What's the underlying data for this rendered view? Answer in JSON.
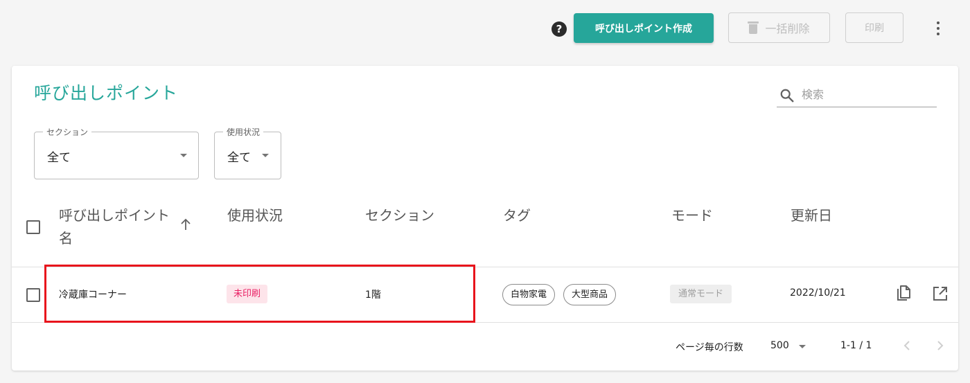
{
  "toolbar": {
    "help_glyph": "?",
    "create_label": "呼び出しポイント作成",
    "bulk_delete_label": "一括削除",
    "print_label": "印刷"
  },
  "card": {
    "title": "呼び出しポイント",
    "search_placeholder": "検索"
  },
  "filters": {
    "section": {
      "label": "セクション",
      "value": "全て"
    },
    "status": {
      "label": "使用状況",
      "value": "全て"
    }
  },
  "table": {
    "headers": {
      "name": "呼び出しポイント名",
      "status": "使用状況",
      "section": "セクション",
      "tags": "タグ",
      "mode": "モード",
      "updated": "更新日"
    },
    "rows": [
      {
        "name": "冷蔵庫コーナー",
        "status": "未印刷",
        "section": "1階",
        "tags": [
          "白物家電",
          "大型商品"
        ],
        "mode": "通常モード",
        "updated": "2022/10/21"
      }
    ]
  },
  "pagination": {
    "rows_per_page_label": "ページ毎の行数",
    "rows_per_page": "500",
    "range": "1-1 / 1"
  },
  "colors": {
    "accent": "#26a69a",
    "status_unprinted": "#e91e63",
    "highlight": "#e8141c"
  },
  "icons": [
    "help-icon",
    "trash-icon",
    "more-vert-icon",
    "search-icon",
    "arrow-up-icon",
    "copy-icon",
    "open-in-new-icon",
    "chevron-left-icon",
    "chevron-right-icon"
  ]
}
